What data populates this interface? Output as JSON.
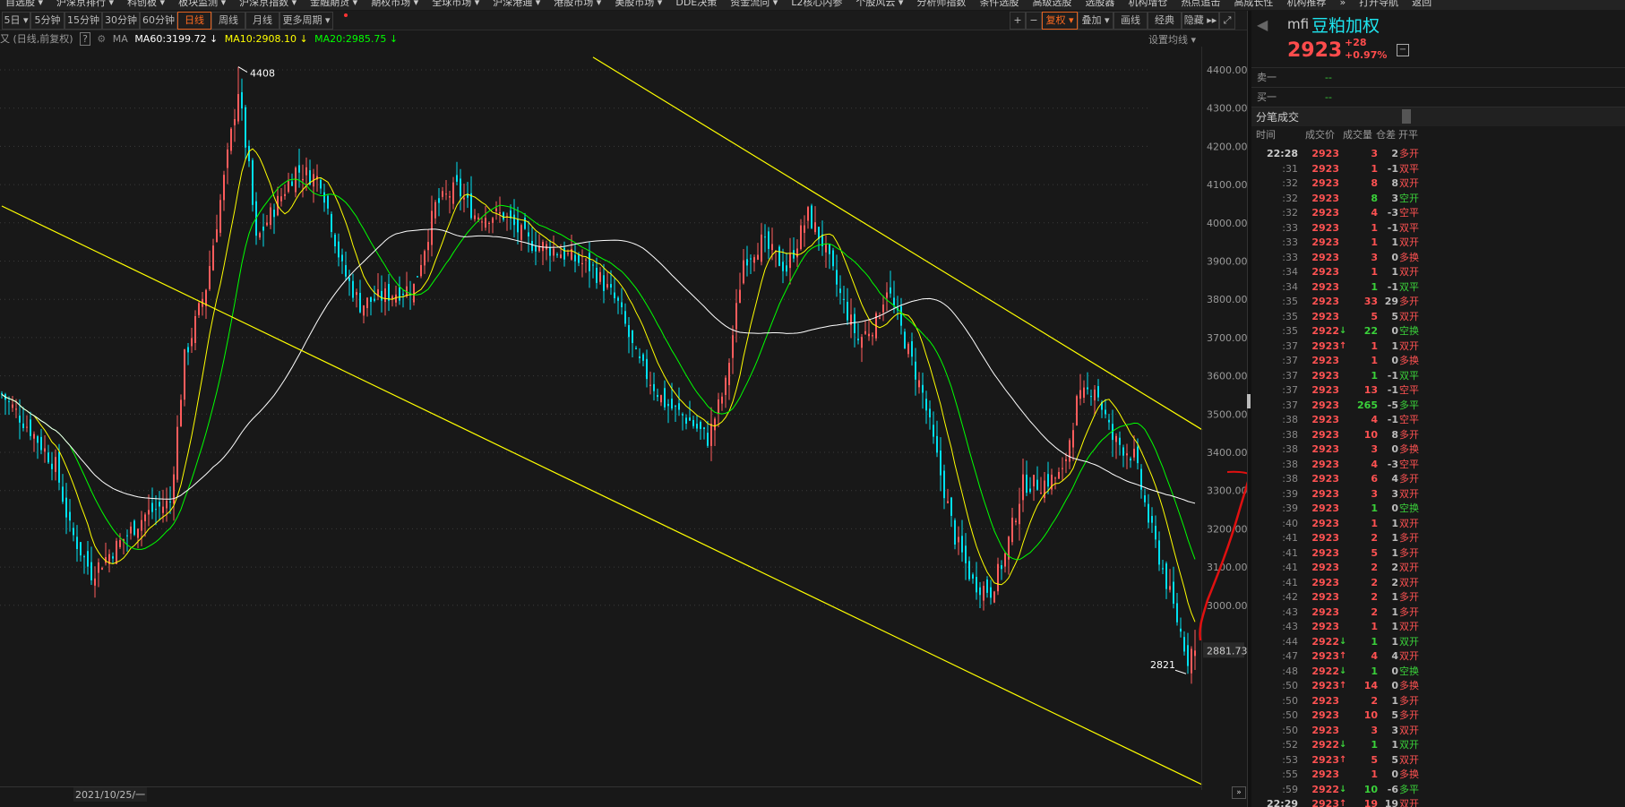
{
  "menu": [
    "自选股 ▾",
    "沪深京排行 ▾",
    "科创板 ▾",
    "板块监测 ▾",
    "沪深京指数 ▾",
    "金融期货 ▾",
    "期权市场 ▾",
    "全球市场 ▾",
    "沪深港通 ▾",
    "港股市场 ▾",
    "美股市场 ▾",
    "DDE决策",
    "资金流向 ▾",
    "L2核心内参",
    "个股风云 ▾",
    "分析师指数",
    "条件选股",
    "高级选股",
    "选股器",
    "机构增仓",
    "热点追击",
    "高成长性",
    "机构推荐",
    "»",
    "打开导航",
    "返回"
  ],
  "toolbar": {
    "periods": [
      "5日 ▾",
      "5分钟",
      "15分钟",
      "30分钟",
      "60分钟",
      "日线",
      "周线",
      "月线",
      "更多周期 ▾"
    ],
    "active_period": "日线",
    "right": [
      "+",
      "−",
      "复权 ▾",
      "叠加 ▾",
      "画线",
      "经典",
      "隐藏 ▸▸",
      "⤢"
    ]
  },
  "ma_row": {
    "prefix": "又 (日线,前复权)",
    "help": "?",
    "ma_label": "MA",
    "ma60": "MA60:3199.72 ↓",
    "ma10": "MA10:2908.10 ↓",
    "ma20": "MA20:2985.75 ↓",
    "set_ma": "设置均线 ▾"
  },
  "colors": {
    "up": "#ff5c5c",
    "down": "#00e0f0",
    "ma10": "#ffff00",
    "ma20": "#00ff00",
    "ma60": "#ffffff",
    "trendline": "#ffff00",
    "accent": "#ff6a1f"
  },
  "chart_data": {
    "type": "candlestick",
    "period": "日线",
    "ylim": [
      2800,
      4420
    ],
    "yticks": [
      "4400.00",
      "4300.00",
      "4200.00",
      "4100.00",
      "4000.00",
      "3900.00",
      "3800.00",
      "3700.00",
      "3600.00",
      "3500.00",
      "3400.00",
      "3300.00",
      "3200.00",
      "3100.00",
      "3000.00"
    ],
    "current_price_label": "2881.73",
    "x_label": "2021/10/25/一",
    "candle_count": 334,
    "close_path": [
      [
        0,
        3552
      ],
      [
        8,
        3459
      ],
      [
        15,
        3365
      ],
      [
        19,
        3200
      ],
      [
        25,
        3084
      ],
      [
        32,
        3154
      ],
      [
        40,
        3236
      ],
      [
        47,
        3271
      ],
      [
        51,
        3646
      ],
      [
        57,
        3833
      ],
      [
        62,
        4114
      ],
      [
        66,
        4348
      ],
      [
        69,
        4138
      ],
      [
        71,
        3950
      ],
      [
        75,
        4021
      ],
      [
        82,
        4138
      ],
      [
        89,
        4114
      ],
      [
        95,
        3880
      ],
      [
        100,
        3786
      ],
      [
        107,
        3810
      ],
      [
        115,
        3833
      ],
      [
        121,
        4044
      ],
      [
        127,
        4091
      ],
      [
        132,
        4021
      ],
      [
        140,
        4021
      ],
      [
        147,
        3950
      ],
      [
        155,
        3927
      ],
      [
        165,
        3880
      ],
      [
        172,
        3786
      ],
      [
        177,
        3646
      ],
      [
        185,
        3529
      ],
      [
        192,
        3482
      ],
      [
        197,
        3435
      ],
      [
        202,
        3576
      ],
      [
        207,
        3904
      ],
      [
        212,
        3950
      ],
      [
        219,
        3880
      ],
      [
        225,
        4021
      ],
      [
        229,
        3950
      ],
      [
        234,
        3810
      ],
      [
        239,
        3693
      ],
      [
        244,
        3740
      ],
      [
        247,
        3833
      ],
      [
        252,
        3693
      ],
      [
        257,
        3552
      ],
      [
        262,
        3342
      ],
      [
        266,
        3178
      ],
      [
        271,
        3060
      ],
      [
        276,
        3037
      ],
      [
        280,
        3131
      ],
      [
        285,
        3318
      ],
      [
        290,
        3318
      ],
      [
        296,
        3342
      ],
      [
        300,
        3529
      ],
      [
        305,
        3576
      ],
      [
        310,
        3435
      ],
      [
        316,
        3389
      ],
      [
        320,
        3224
      ],
      [
        325,
        3060
      ],
      [
        330,
        2896
      ],
      [
        331,
        2860
      ],
      [
        333,
        2908
      ]
    ],
    "annotations": [
      {
        "text": "4408",
        "index": 66,
        "price": 4408
      },
      {
        "text": "2821",
        "index": 331,
        "price": 2821
      }
    ],
    "trendlines": [
      {
        "from": [
          165,
          4433
        ],
        "to": [
          335,
          3459
        ]
      },
      {
        "from": [
          0,
          4044
        ],
        "to": [
          335,
          2531
        ]
      }
    ],
    "ma_periods": [
      10,
      20,
      60
    ]
  },
  "panel": {
    "code": "mfi",
    "name": "豆粕加权",
    "price": "2923",
    "change": "+28",
    "change_pct": "+0.97%",
    "btn": "−",
    "sell1_label": "卖一",
    "sell1_value": "--",
    "buy1_label": "买一",
    "buy1_value": "--",
    "ticks_title": "分笔成交",
    "columns": [
      "时间",
      "成交价",
      "成交量",
      "仓差",
      "开平"
    ],
    "ticks": [
      [
        "22:28",
        "2923",
        "",
        "3",
        "r",
        "2",
        "多开",
        "r"
      ],
      [
        ":31",
        "2923",
        "",
        "1",
        "r",
        "-1",
        "双平",
        "r"
      ],
      [
        ":32",
        "2923",
        "",
        "8",
        "r",
        "8",
        "双开",
        "r"
      ],
      [
        ":32",
        "2923",
        "",
        "8",
        "g",
        "3",
        "空开",
        "g"
      ],
      [
        ":32",
        "2923",
        "",
        "4",
        "r",
        "-3",
        "空平",
        "r"
      ],
      [
        ":33",
        "2923",
        "",
        "1",
        "r",
        "-1",
        "双平",
        "r"
      ],
      [
        ":33",
        "2923",
        "",
        "1",
        "r",
        "1",
        "双开",
        "r"
      ],
      [
        ":33",
        "2923",
        "",
        "3",
        "r",
        "0",
        "多换",
        "r"
      ],
      [
        ":34",
        "2923",
        "",
        "1",
        "r",
        "1",
        "双开",
        "r"
      ],
      [
        ":34",
        "2923",
        "",
        "1",
        "g",
        "-1",
        "双平",
        "g"
      ],
      [
        ":35",
        "2923",
        "",
        "33",
        "r",
        "29",
        "多开",
        "r"
      ],
      [
        ":35",
        "2923",
        "",
        "5",
        "r",
        "5",
        "双开",
        "r"
      ],
      [
        ":35",
        "2922",
        "↓",
        "22",
        "g",
        "0",
        "空换",
        "g"
      ],
      [
        ":37",
        "2923",
        "↑",
        "1",
        "r",
        "1",
        "双开",
        "r"
      ],
      [
        ":37",
        "2923",
        "",
        "1",
        "r",
        "0",
        "多换",
        "r"
      ],
      [
        ":37",
        "2923",
        "",
        "1",
        "g",
        "-1",
        "双平",
        "g"
      ],
      [
        ":37",
        "2923",
        "",
        "13",
        "r",
        "-1",
        "空平",
        "r"
      ],
      [
        ":37",
        "2923",
        "",
        "265",
        "g",
        "-5",
        "多平",
        "g"
      ],
      [
        ":38",
        "2923",
        "",
        "4",
        "r",
        "-1",
        "空平",
        "r"
      ],
      [
        ":38",
        "2923",
        "",
        "10",
        "r",
        "8",
        "多开",
        "r"
      ],
      [
        ":38",
        "2923",
        "",
        "3",
        "r",
        "0",
        "多换",
        "r"
      ],
      [
        ":38",
        "2923",
        "",
        "4",
        "r",
        "-3",
        "空平",
        "r"
      ],
      [
        ":38",
        "2923",
        "",
        "6",
        "r",
        "4",
        "多开",
        "r"
      ],
      [
        ":39",
        "2923",
        "",
        "3",
        "r",
        "3",
        "双开",
        "r"
      ],
      [
        ":39",
        "2923",
        "",
        "1",
        "g",
        "0",
        "空换",
        "g"
      ],
      [
        ":40",
        "2923",
        "",
        "1",
        "r",
        "1",
        "双开",
        "r"
      ],
      [
        ":41",
        "2923",
        "",
        "2",
        "r",
        "1",
        "多开",
        "r"
      ],
      [
        ":41",
        "2923",
        "",
        "5",
        "r",
        "1",
        "多开",
        "r"
      ],
      [
        ":41",
        "2923",
        "",
        "2",
        "r",
        "2",
        "双开",
        "r"
      ],
      [
        ":41",
        "2923",
        "",
        "2",
        "r",
        "2",
        "双开",
        "r"
      ],
      [
        ":42",
        "2923",
        "",
        "2",
        "r",
        "1",
        "多开",
        "r"
      ],
      [
        ":43",
        "2923",
        "",
        "2",
        "r",
        "1",
        "多开",
        "r"
      ],
      [
        ":43",
        "2923",
        "",
        "1",
        "r",
        "1",
        "双开",
        "r"
      ],
      [
        ":44",
        "2922",
        "↓",
        "1",
        "g",
        "1",
        "双开",
        "g"
      ],
      [
        ":47",
        "2923",
        "↑",
        "4",
        "r",
        "4",
        "双开",
        "r"
      ],
      [
        ":48",
        "2922",
        "↓",
        "1",
        "g",
        "0",
        "空换",
        "g"
      ],
      [
        ":50",
        "2923",
        "↑",
        "14",
        "r",
        "0",
        "多换",
        "r"
      ],
      [
        ":50",
        "2923",
        "",
        "2",
        "r",
        "1",
        "多开",
        "r"
      ],
      [
        ":50",
        "2923",
        "",
        "10",
        "r",
        "5",
        "多开",
        "r"
      ],
      [
        ":50",
        "2923",
        "",
        "3",
        "r",
        "3",
        "双开",
        "r"
      ],
      [
        ":52",
        "2922",
        "↓",
        "1",
        "g",
        "1",
        "双开",
        "g"
      ],
      [
        ":53",
        "2923",
        "↑",
        "5",
        "r",
        "5",
        "双开",
        "r"
      ],
      [
        ":55",
        "2923",
        "",
        "1",
        "r",
        "0",
        "多换",
        "r"
      ],
      [
        ":59",
        "2922",
        "↓",
        "10",
        "g",
        "-6",
        "多平",
        "g"
      ],
      [
        "22:29",
        "2923",
        "↑",
        "19",
        "r",
        "19",
        "双开",
        "r"
      ]
    ]
  }
}
